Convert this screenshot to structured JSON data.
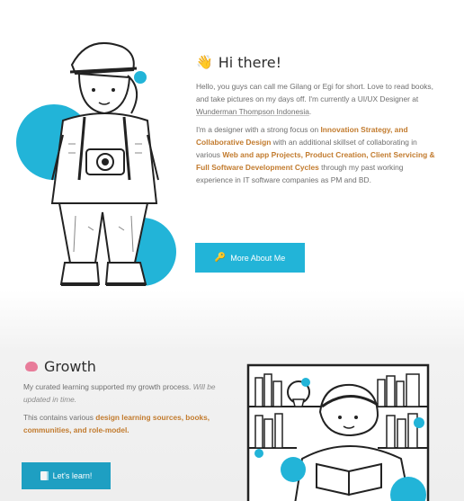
{
  "hero": {
    "title_emoji": "👋",
    "title": "Hi there!",
    "intro": {
      "part1": "Hello, you guys can call me Gilang or Egi for short. Love to read books, and take pictures on my days off. I'm currently a UI/UX Designer at ",
      "company_link": "Wunderman Thompson Indonesia",
      "part2": "."
    },
    "focus": {
      "part1": "I'm a designer with a strong focus on ",
      "hl1": "Innovation Strategy, and Collaborative Design",
      "part2": " with an additional skillset of collaborating in various ",
      "hl2": "Web and app Projects, Product Creation, Client Servicing & Full Software Development Cycles",
      "part3": " through my past working experience in IT software companies as PM and BD."
    },
    "more_button": "More About Me",
    "more_button_icon": "key-icon"
  },
  "growth": {
    "title": "Growth",
    "title_icon": "brain-icon",
    "line1_part1": "My curated learning supported my growth process. ",
    "line1_muted": "Will be updated in time.",
    "line2_part1": "This contains various ",
    "line2_hl1": "design learning sources, books, communities, and role-model.",
    "learn_button": "Let's learn!",
    "learn_button_icon": "book-icon"
  },
  "colors": {
    "accent": "#22b4d8",
    "highlight": "#c27b2e",
    "text": "#6f6f6f",
    "heading": "#2e2e2e"
  }
}
